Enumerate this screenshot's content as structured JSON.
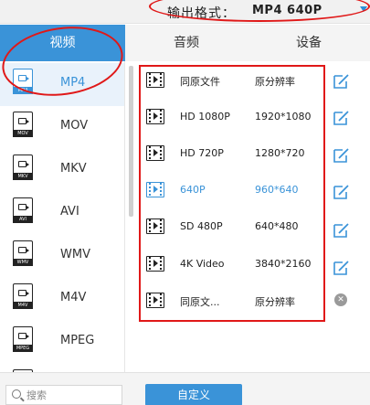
{
  "header": {
    "output_format_label": "输出格式：",
    "output_format_value": "MP4  640P"
  },
  "tabs": [
    {
      "label": "视频",
      "selected": true
    },
    {
      "label": "音频",
      "selected": false
    },
    {
      "label": "设备",
      "selected": false
    }
  ],
  "formats": [
    {
      "name": "MP4",
      "badge": "MP4",
      "selected": true
    },
    {
      "name": "MOV",
      "badge": "MOV",
      "selected": false
    },
    {
      "name": "MKV",
      "badge": "MKV",
      "selected": false
    },
    {
      "name": "AVI",
      "badge": "AVI",
      "selected": false
    },
    {
      "name": "WMV",
      "badge": "WMV",
      "selected": false
    },
    {
      "name": "M4V",
      "badge": "M4V",
      "selected": false
    },
    {
      "name": "MPEG",
      "badge": "MPEG",
      "selected": false
    }
  ],
  "presets": [
    {
      "name": "同原文件",
      "resolution": "原分辨率",
      "action": "edit-icon",
      "active": false
    },
    {
      "name": "HD 1080P",
      "resolution": "1920*1080",
      "action": "edit-icon",
      "active": false
    },
    {
      "name": "HD 720P",
      "resolution": "1280*720",
      "action": "edit-icon",
      "active": false
    },
    {
      "name": "640P",
      "resolution": "960*640",
      "action": "edit-icon",
      "active": true
    },
    {
      "name": "SD 480P",
      "resolution": "640*480",
      "action": "edit-icon",
      "active": false
    },
    {
      "name": "4K Video",
      "resolution": "3840*2160",
      "action": "edit-icon",
      "active": false
    },
    {
      "name": "同原文...",
      "resolution": "原分辨率",
      "action": "remove-icon",
      "active": false
    }
  ],
  "footer": {
    "search_placeholder": "搜索",
    "custom_button": "自定义"
  },
  "colors": {
    "accent": "#3a93d8",
    "annotation_red": "#e01818"
  }
}
